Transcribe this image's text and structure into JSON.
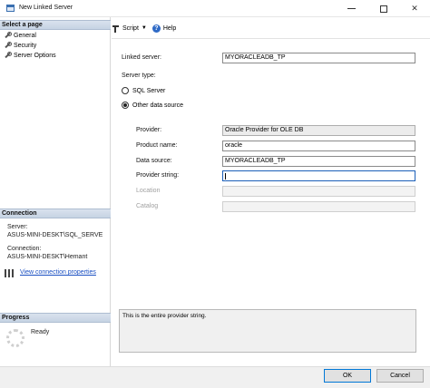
{
  "window": {
    "title": "New Linked Server",
    "minimize": "—",
    "maximize": "□",
    "close": "✕"
  },
  "sidebar": {
    "select_page_header": "Select a page",
    "pages": [
      {
        "label": "General",
        "icon": "wrench-icon"
      },
      {
        "label": "Security",
        "icon": "wrench-icon"
      },
      {
        "label": "Server Options",
        "icon": "wrench-icon"
      }
    ],
    "connection_header": "Connection",
    "server_label": "Server:",
    "server_value": "ASUS-MINI-DESKT\\SQL_SERVE",
    "connection_label": "Connection:",
    "connection_value": "ASUS-MINI-DESKT\\Hemant",
    "view_connection_link": "View connection properties",
    "progress_header": "Progress",
    "progress_status": "Ready"
  },
  "toolbar": {
    "script_label": "Script",
    "help_label": "Help"
  },
  "form": {
    "linked_server_label": "Linked server:",
    "linked_server_value": "MYORACLEADB_TP",
    "server_type_label": "Server type:",
    "sql_server_label": "SQL Server",
    "other_source_label": "Other data source",
    "provider_label": "Provider:",
    "provider_value": "Oracle Provider for OLE DB",
    "product_name_label": "Product name:",
    "product_name_value": "oracle",
    "data_source_label": "Data source:",
    "data_source_value": "MYORACLEADB_TP",
    "provider_string_label": "Provider string:",
    "provider_string_value": "",
    "location_label": "Location",
    "location_value": "",
    "catalog_label": "Catalog",
    "catalog_value": "",
    "description": "This is the entire provider string."
  },
  "buttons": {
    "ok": "OK",
    "cancel": "Cancel"
  },
  "colors": {
    "header_bg": "#c6d3e3",
    "link": "#1a4fc2",
    "accent": "#0078d7"
  }
}
